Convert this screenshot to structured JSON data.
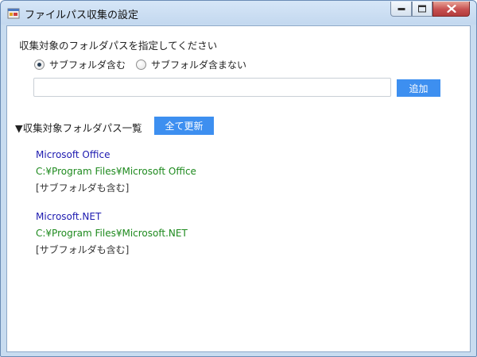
{
  "window": {
    "title": "ファイルパス収集の設定",
    "accent": "#3d8ff0"
  },
  "form": {
    "instruction": "収集対象のフォルダパスを指定してください",
    "radio_include": "サブフォルダ含む",
    "radio_exclude": "サブフォルダ含まない",
    "selected_option": "サブフォルダ含む",
    "path_value": "",
    "add_label": "追加"
  },
  "list": {
    "header": "▼収集対象フォルダパス一覧",
    "refresh_label": "全て更新",
    "entries": [
      {
        "name": "Microsoft Office",
        "path": "C:¥Program Files¥Microsoft Office",
        "option": "[サブフォルダも含む]"
      },
      {
        "name": "Microsoft.NET",
        "path": "C:¥Program Files¥Microsoft.NET",
        "option": "[サブフォルダも含む]"
      }
    ]
  },
  "colors": {
    "name": "#1d1ab0",
    "path": "#1e8a1e",
    "button": "#3d8ff0",
    "close": "#c75050"
  }
}
